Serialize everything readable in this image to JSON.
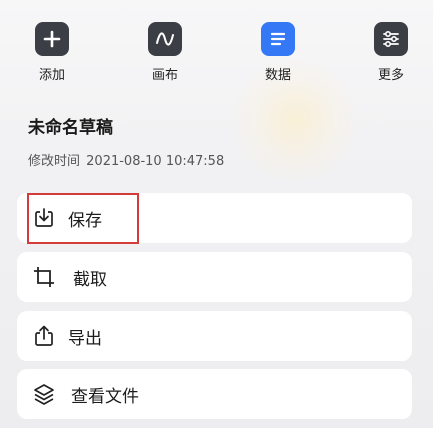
{
  "toolbar": {
    "items": [
      {
        "label": "添加",
        "icon": "plus-icon"
      },
      {
        "label": "画布",
        "icon": "wave-icon"
      },
      {
        "label": "数据",
        "icon": "document-lines-icon"
      },
      {
        "label": "更多",
        "icon": "sliders-icon"
      }
    ],
    "active_color": "#3478f6",
    "icon_bg_color": "#3b3f45"
  },
  "draft": {
    "title": "未命名草稿",
    "modified_label": "修改时间",
    "modified_value": "2021-08-10 10:47:58"
  },
  "menu": {
    "items": [
      {
        "label": "保存",
        "icon": "save-download-icon"
      },
      {
        "label": "截取",
        "icon": "crop-icon"
      },
      {
        "label": "导出",
        "icon": "share-export-icon"
      },
      {
        "label": "查看文件",
        "icon": "layers-icon"
      }
    ],
    "highlight_color": "#d43b3b"
  }
}
